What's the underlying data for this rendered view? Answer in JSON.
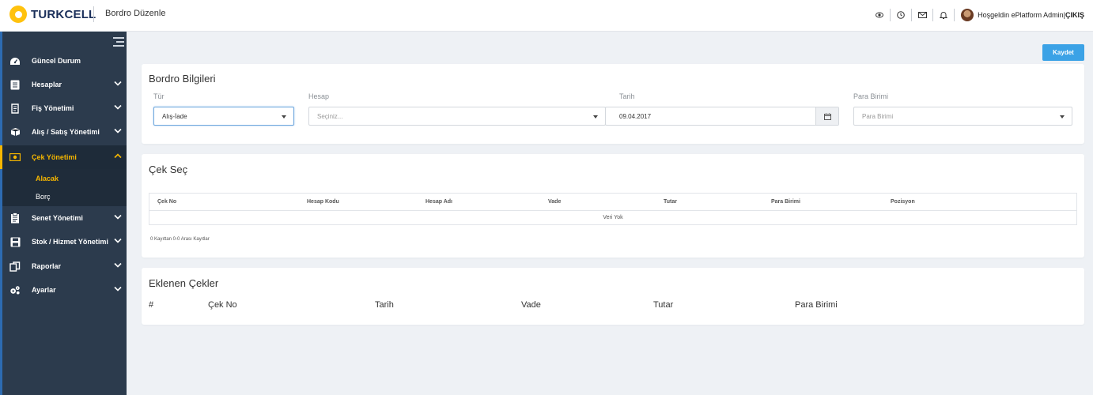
{
  "header": {
    "brand": "TURKCELL",
    "page_title": "Bordro Düzenle",
    "welcome": "Hoşgeldin ePlatform Admin",
    "separator": "|",
    "logout": "ÇIKIŞ"
  },
  "sidebar": {
    "items": [
      {
        "label": "Güncel Durum"
      },
      {
        "label": "Hesaplar"
      },
      {
        "label": "Fiş Yönetimi"
      },
      {
        "label": "Alış / Satış Yönetimi"
      },
      {
        "label": "Çek Yönetimi"
      },
      {
        "label": "Senet Yönetimi"
      },
      {
        "label": "Stok / Hizmet Yönetimi"
      },
      {
        "label": "Raporlar"
      },
      {
        "label": "Ayarlar"
      }
    ],
    "submenu": [
      {
        "label": "Alacak"
      },
      {
        "label": "Borç"
      }
    ]
  },
  "toolbar": {
    "save_label": "Kaydet"
  },
  "bordro": {
    "title": "Bordro Bilgileri",
    "tur_label": "Tür",
    "tur_value": "Alış-İade",
    "hesap_label": "Hesap",
    "hesap_placeholder": "Seçiniz...",
    "tarih_label": "Tarih",
    "tarih_value": "09.04.2017",
    "para_label": "Para Birimi",
    "para_placeholder": "Para Birimi"
  },
  "cek_sec": {
    "title": "Çek Seç",
    "columns": [
      "Çek No",
      "Hesap Kodu",
      "Hesap Adı",
      "Vade",
      "Tutar",
      "Para Birimi",
      "Pozisyon"
    ],
    "empty_text": "Veri Yok",
    "info": "0 Kayıttan 0-0 Arası Kayıtlar"
  },
  "eklenen": {
    "title": "Eklenen Çekler",
    "columns": [
      "#",
      "Çek No",
      "Tarih",
      "Vade",
      "Tutar",
      "Para Birimi"
    ]
  },
  "colors": {
    "sidebar_bg": "#2c3b4d",
    "accent": "#f5b600",
    "primary_button": "#3ba2e6"
  }
}
